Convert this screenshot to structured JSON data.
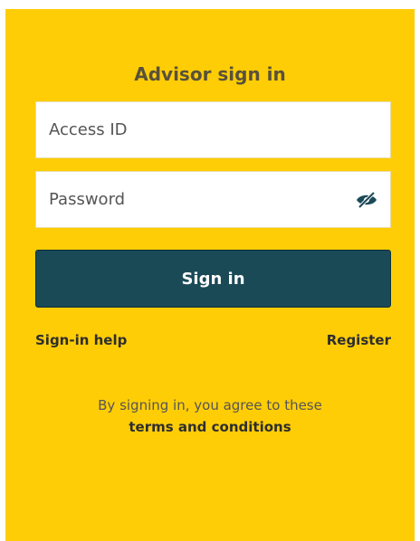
{
  "form": {
    "title": "Advisor sign in",
    "access_id": {
      "placeholder": "Access ID",
      "value": ""
    },
    "password": {
      "placeholder": "Password",
      "value": ""
    },
    "password_toggle_icon": "eye-slash-icon",
    "submit_label": "Sign in"
  },
  "links": {
    "help": "Sign-in help",
    "register": "Register"
  },
  "agreement": {
    "text": "By signing in, you agree to these",
    "terms_link": "terms and conditions"
  },
  "colors": {
    "background": "#ffcd06",
    "button": "#1b4a57",
    "title": "#59513a"
  }
}
